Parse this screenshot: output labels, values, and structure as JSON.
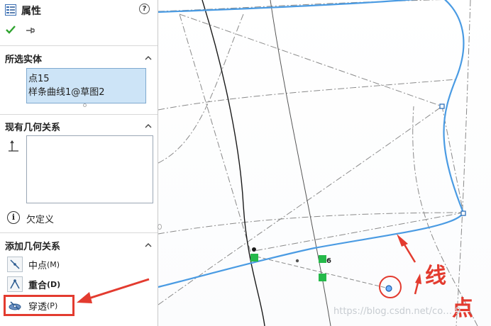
{
  "panel": {
    "title": "属性",
    "help": "?",
    "selected": {
      "title": "所选实体",
      "items": [
        "点15",
        "样条曲线1@草图2"
      ]
    },
    "existing": {
      "title": "现有几何关系",
      "status": "欠定义"
    },
    "add": {
      "title": "添加几何关系",
      "items": [
        {
          "label": "中点",
          "key": "(M)"
        },
        {
          "label": "重合",
          "key": "(D)"
        },
        {
          "label": "穿透",
          "key": "(P)"
        }
      ]
    }
  },
  "viewport": {
    "dim_label": "6"
  },
  "annotations": {
    "line_label": "线",
    "point_label": "点",
    "color": "#e33b2f"
  },
  "watermark": "https://blog.csdn.net/co…  9"
}
